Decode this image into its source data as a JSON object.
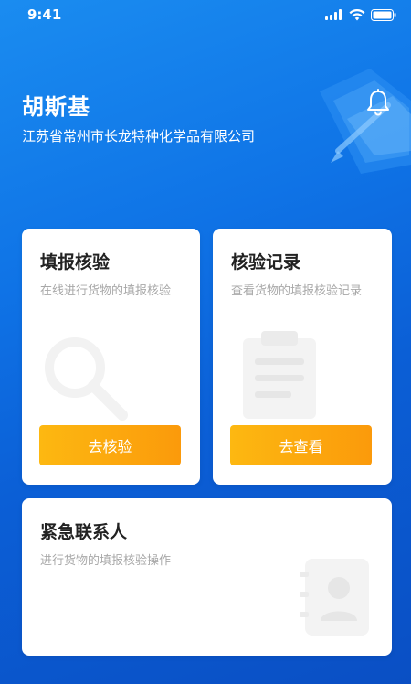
{
  "status_bar": {
    "time": "9:41"
  },
  "header": {
    "name": "胡斯基",
    "company": "江苏省常州市长龙特种化学品有限公司"
  },
  "cards": {
    "verify": {
      "title": "填报核验",
      "description": "在线进行货物的填报核验",
      "button_label": "去核验",
      "bg_icon": "search-icon"
    },
    "records": {
      "title": "核验记录",
      "description": "查看货物的填报核验记录",
      "button_label": "去查看",
      "bg_icon": "clipboard-icon"
    },
    "contact": {
      "title": "紧急联系人",
      "description": "进行货物的填报核验操作",
      "bg_icon": "contact-card-icon"
    }
  },
  "colors": {
    "background_start": "#1a8cf0",
    "background_end": "#0a4fc4",
    "button_start": "#fdb811",
    "button_end": "#fb9a0b"
  }
}
